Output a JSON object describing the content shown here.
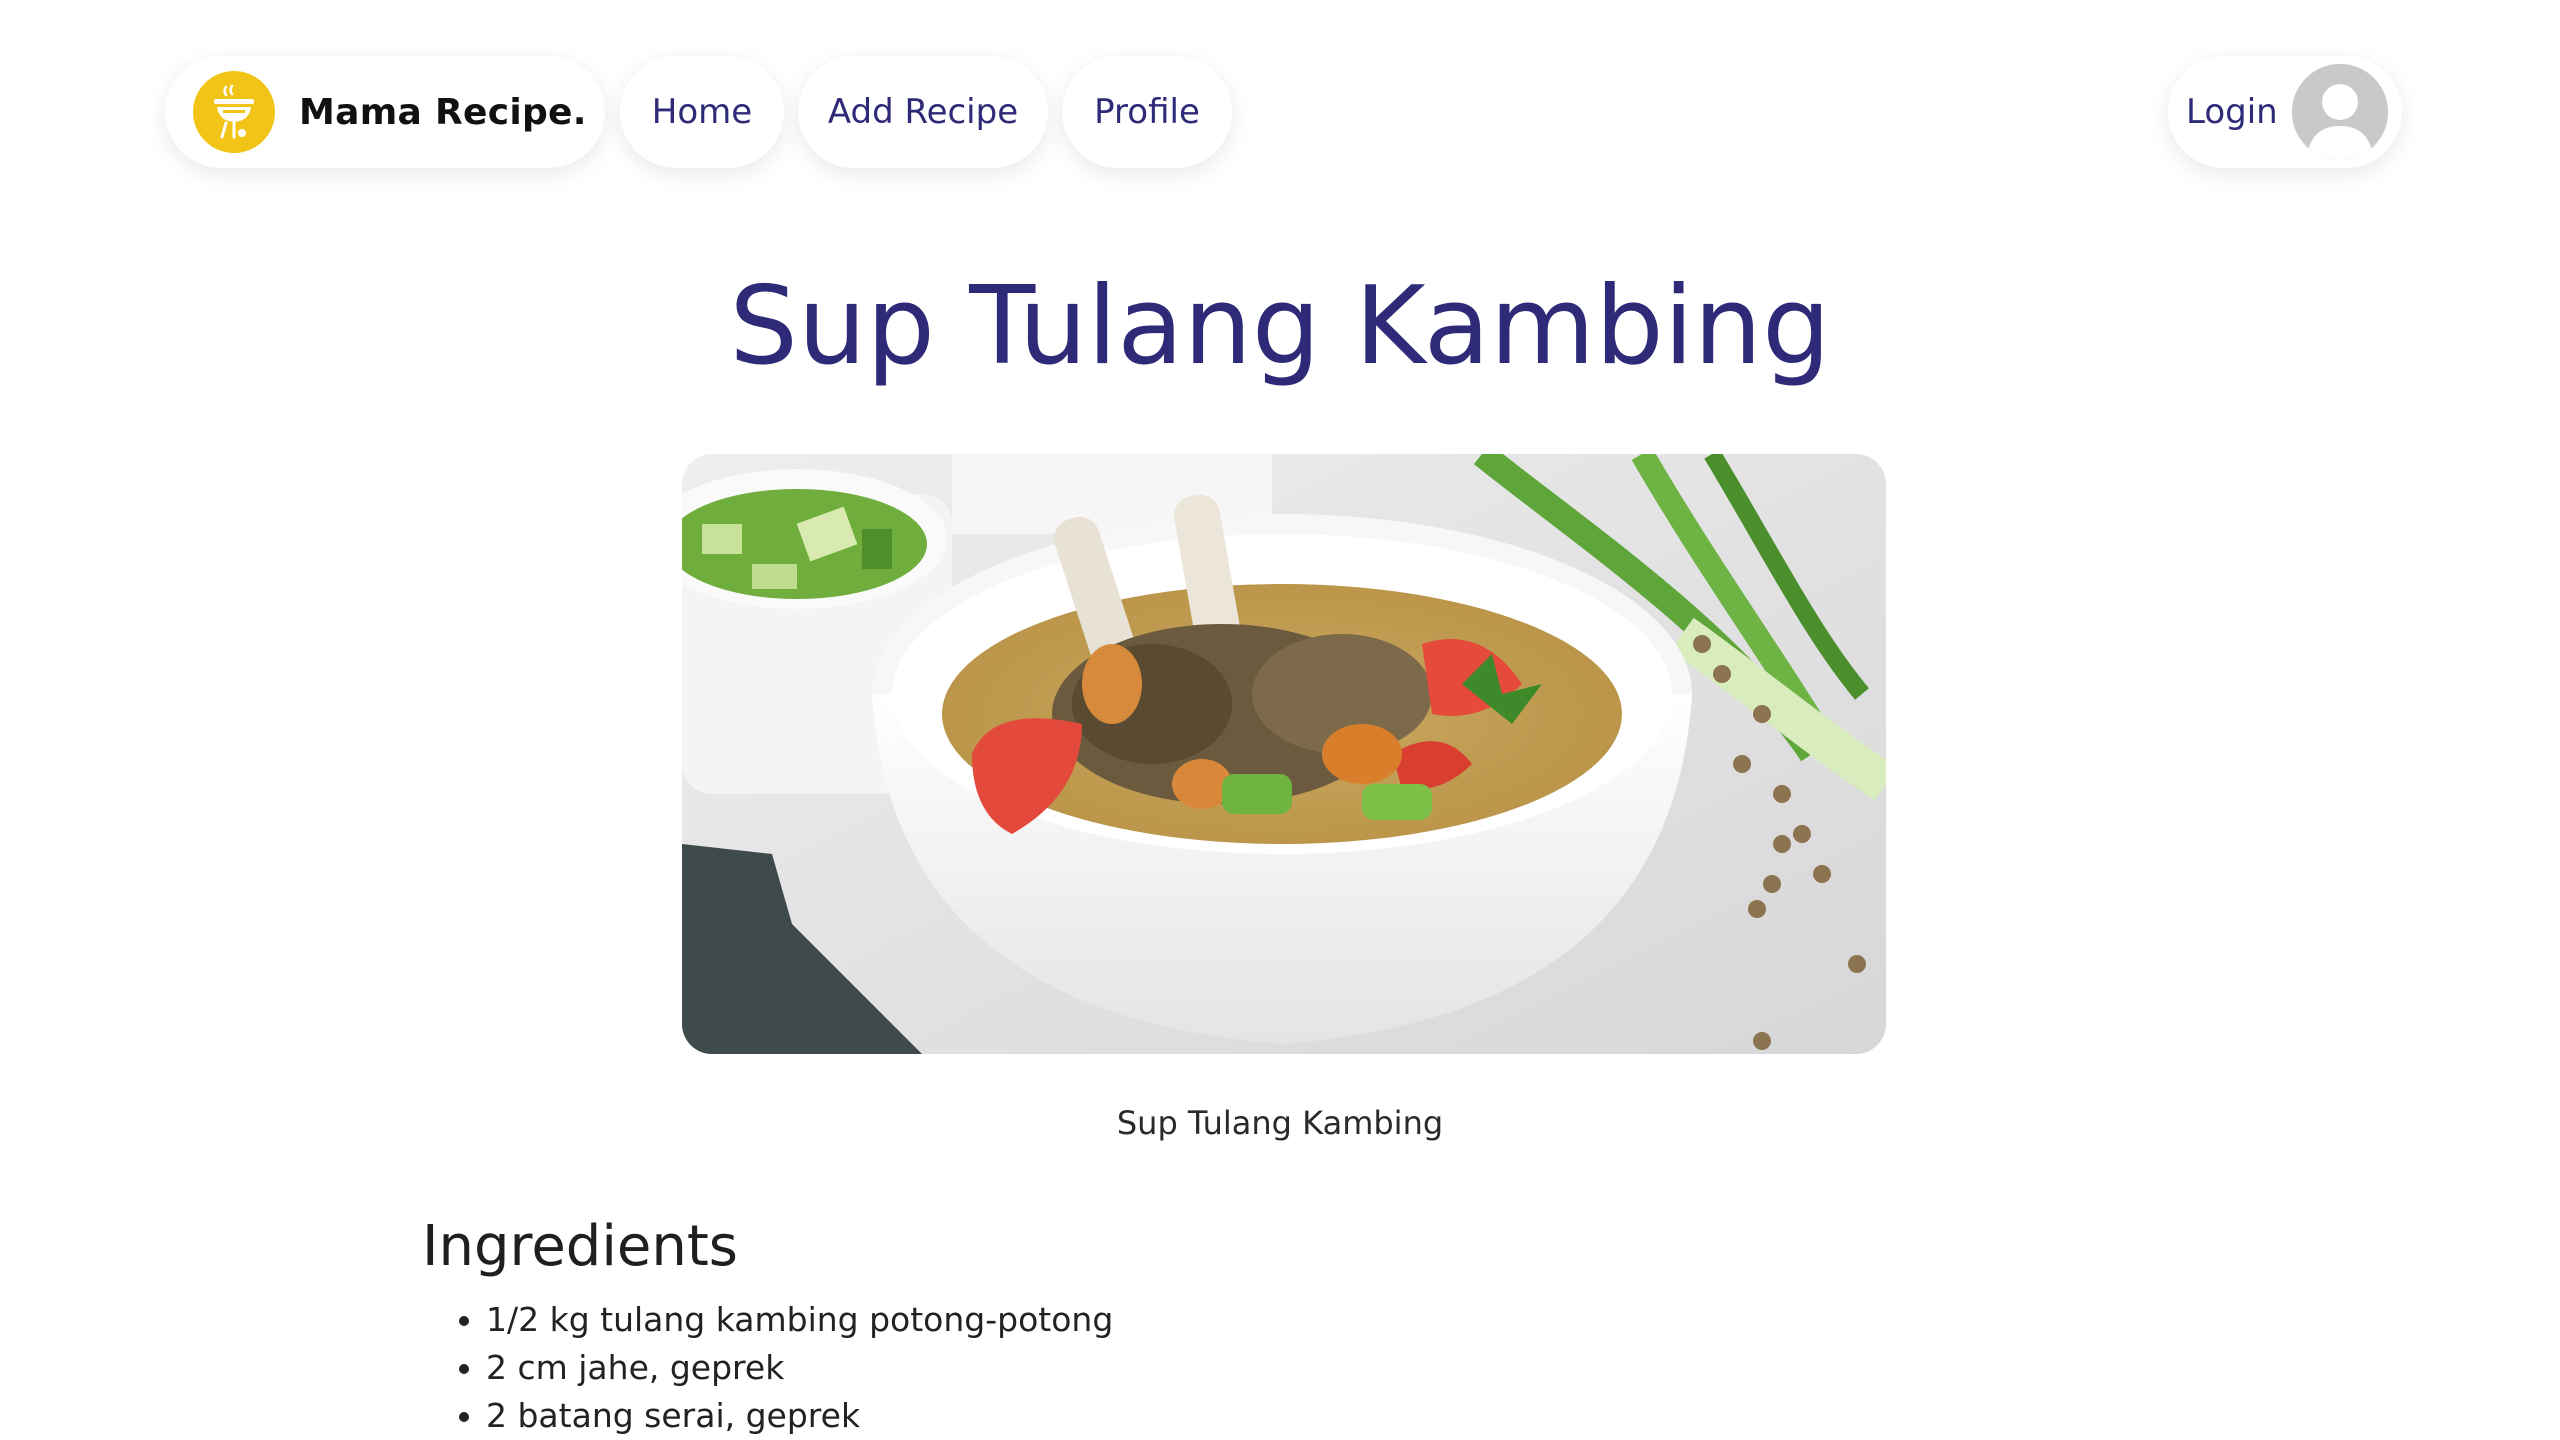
{
  "colors": {
    "accent": "#2e2a78",
    "logo_bg": "#f2c418",
    "text": "#222222"
  },
  "navbar": {
    "brand": {
      "name": "Mama Recipe.",
      "logo_icon": "grill-icon"
    },
    "links": [
      {
        "label": "Home"
      },
      {
        "label": "Add Recipe"
      },
      {
        "label": "Profile"
      }
    ],
    "login_label": "Login",
    "avatar_icon": "user-avatar-icon"
  },
  "recipe": {
    "title": "Sup Tulang Kambing",
    "image_caption": "Sup Tulang Kambing",
    "ingredients_heading": "Ingredients",
    "ingredients": [
      "1/2 kg tulang kambing potong-potong",
      "2 cm jahe, geprek",
      "2 batang serai, geprek"
    ]
  }
}
